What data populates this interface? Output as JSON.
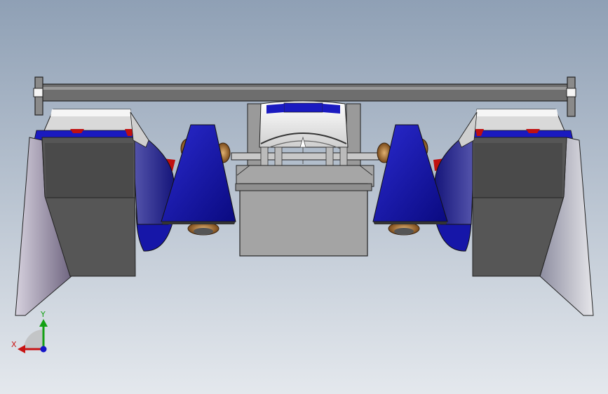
{
  "viewport": {
    "background_top": "#8fa0b5",
    "background_bottom": "#e4e8ed"
  },
  "model": {
    "colors": {
      "blue": "#1414b8",
      "blue_dark": "#0a0a7a",
      "body_white": "#f2f2f2",
      "gray_light": "#a6a6a6",
      "gray_mid": "#6e6e6e",
      "gray_dark": "#4a4a4a",
      "wing_purple": "#7a6f8c",
      "red": "#c01010",
      "bronze": "#b07a3a"
    }
  },
  "triad": {
    "x_label": "X",
    "y_label": "Y",
    "x_color": "#c81414",
    "y_color": "#14a014",
    "z_color": "#1414c8"
  }
}
